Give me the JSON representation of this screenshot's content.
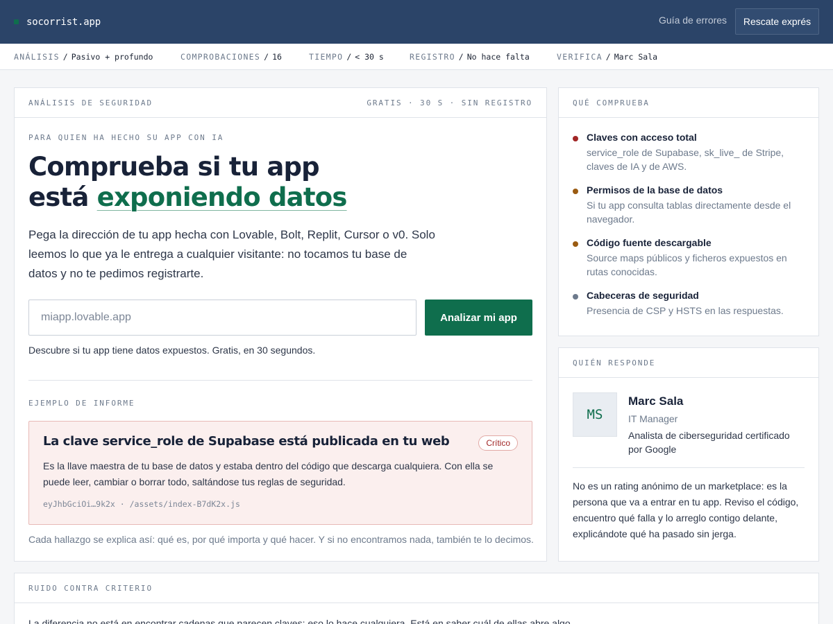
{
  "header": {
    "brand": "socorrist.app",
    "nav_link": "Guía de errores",
    "cta": "Rescate exprés",
    "accent": "#0f6e4d",
    "bar_color": "#2b4468"
  },
  "meta": [
    {
      "key": "ANÁLISIS",
      "value": "Pasivo + profundo"
    },
    {
      "key": "COMPROBACIONES",
      "value": "16"
    },
    {
      "key": "TIEMPO",
      "value": "< 30 s"
    },
    {
      "key": "REGISTRO",
      "value": "No hace falta"
    },
    {
      "key": "VERIFICA",
      "value": "Marc Sala"
    }
  ],
  "analysis": {
    "label": "ANÁLISIS DE SEGURIDAD",
    "tagline": "GRATIS · 30 S · SIN REGISTRO",
    "eyebrow": "PARA QUIEN HA HECHO SU APP CON IA",
    "title_line1": "Comprueba si tu app",
    "title_line2_prefix": "está ",
    "title_highlight": "exponiendo datos",
    "lead": "Pega la dirección de tu app hecha con Lovable, Bolt, Replit, Cursor o v0. Solo leemos lo que ya le entrega a cualquier visitante: no tocamos tu base de datos y no te pedimos registrarte.",
    "input_value": "",
    "input_placeholder": "miapp.lovable.app",
    "button": "Analizar mi app",
    "hint": "Descubre si tu app tiene datos expuestos. Gratis, en 30 segundos.",
    "example_label": "EJEMPLO DE INFORME",
    "finding": {
      "title": "La clave service_role de Supabase está publicada en tu web",
      "severity": "Crítico",
      "body": "Es la llave maestra de tu base de datos y estaba dentro del código que descarga cualquiera. Con ella se puede leer, cambiar o borrar todo, saltándose tus reglas de seguridad.",
      "code": "eyJhbGciOi…9k2x · /assets/index-B7dK2x.js"
    },
    "footnote": "Cada hallazgo se explica así: qué es, por qué importa y qué hacer. Y si no encontramos nada, también te lo decimos."
  },
  "checks": {
    "label": "QUÉ COMPRUEBA",
    "items": [
      {
        "title": "Claves con acceso total",
        "desc": "service_role de Supabase, sk_live_ de Stripe, claves de IA y de AWS.",
        "color": "#a12626"
      },
      {
        "title": "Permisos de la base de datos",
        "desc": "Si tu app consulta tablas directamente desde el navegador.",
        "color": "#9a5b12"
      },
      {
        "title": "Código fuente descargable",
        "desc": "Source maps públicos y ficheros expuestos en rutas conocidas.",
        "color": "#9a5b12"
      },
      {
        "title": "Cabeceras de seguridad",
        "desc": "Presencia de CSP y HSTS en las respuestas.",
        "color": "#6d7a8c"
      }
    ]
  },
  "responder": {
    "label": "QUIÉN RESPONDE",
    "initials": "MS",
    "name": "Marc Sala",
    "role": "IT Manager",
    "credential": "Analista de ciberseguridad certificado por Google",
    "body": "No es un rating anónimo de un marketplace: es la persona que va a entrar en tu app. Reviso el código, encuentro qué falla y lo arreglo contigo delante, explicándote qué ha pasado sin jerga."
  },
  "bottom": {
    "label": "RUIDO CONTRA CRITERIO",
    "text": "La diferencia no está en encontrar cadenas que parecen claves: eso lo hace cualquiera. Está en saber cuál de ellas abre algo."
  }
}
